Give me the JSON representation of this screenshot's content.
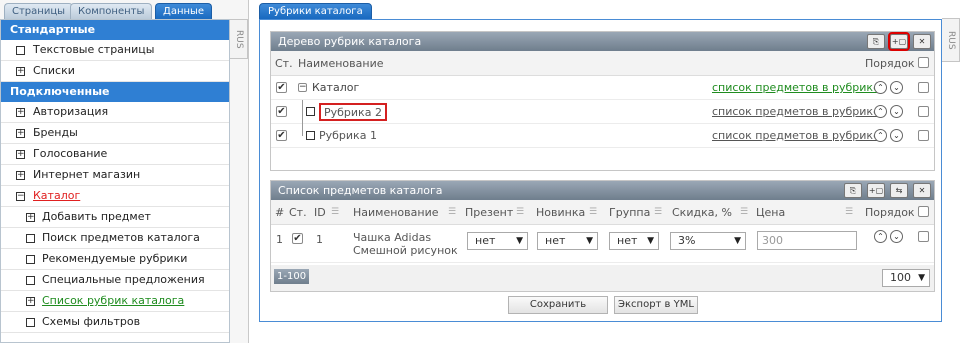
{
  "left": {
    "tabs": [
      "Страницы",
      "Компоненты",
      "Данные"
    ],
    "lang": "RUS",
    "sections": [
      {
        "title": "Стандартные",
        "items": [
          "Текстовые страницы",
          "Списки"
        ]
      },
      {
        "title": "Подключенные",
        "items": [
          "Авторизация",
          "Бренды",
          "Голосование",
          "Интернет магазин",
          "Каталог"
        ]
      }
    ],
    "catalog_children": [
      "Добавить предмет",
      "Поиск предметов каталога",
      "Рекомендуемые рубрики",
      "Специальные предложения",
      "Список рубрик каталога",
      "Схемы фильтров"
    ]
  },
  "right": {
    "tab": "Рубрики каталога",
    "lang": "RUS",
    "tree_panel": {
      "title": "Дерево рубрик каталога",
      "col_status": "Ст.",
      "col_name": "Наименование",
      "col_order": "Порядок",
      "rows": [
        {
          "name": "Каталог",
          "link": "список предметов в рубрике"
        },
        {
          "name": "Рубрика 2",
          "link": "список предметов в рубрике"
        },
        {
          "name": "Рубрика 1",
          "link": "список предметов в рубрике"
        }
      ]
    },
    "items_panel": {
      "title": "Список предметов каталога",
      "columns": [
        "#",
        "Ст.",
        "ID",
        "Наименование",
        "Презент",
        "Новинка",
        "Группа",
        "Скидка, %",
        "Цена",
        "Порядок"
      ],
      "row": {
        "num": "1",
        "id": "1",
        "name_line1": "Чашка Adidas",
        "name_line2": "Смешной рисунок",
        "present": "нет",
        "novelty": "нет",
        "group": "нет",
        "discount": "3%",
        "price": "300"
      },
      "range": "1-100",
      "per_page": "100"
    },
    "save_button": "Сохранить",
    "export_button": "Экспорт в YML"
  },
  "colors": {
    "accent": "#2f7fd3",
    "link_green": "#1f8c1f",
    "highlight": "#e02020"
  }
}
